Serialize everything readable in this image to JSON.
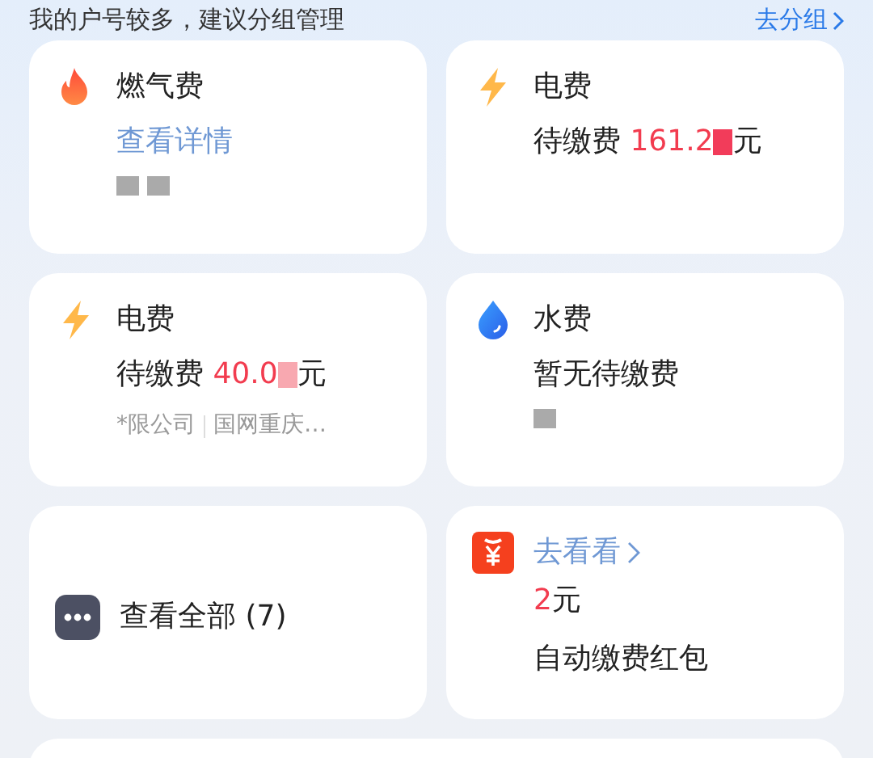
{
  "header": {
    "text": "我的户号较多，建议分组管理",
    "link": "去分组"
  },
  "bills": [
    {
      "kind": "gas",
      "title": "燃气费",
      "link": "查看详情"
    },
    {
      "kind": "electric",
      "title": "电费",
      "label": "待缴费",
      "amount": "161.2",
      "unit": "元"
    },
    {
      "kind": "electric",
      "title": "电费",
      "label": "待缴费",
      "amount": "40.0",
      "unit": "元",
      "notes": [
        "*限公司",
        "国网重庆…"
      ]
    },
    {
      "kind": "water",
      "title": "水费",
      "status": "暂无待缴费"
    }
  ],
  "view_all": {
    "label": "查看全部 (7)"
  },
  "promo": {
    "link": "去看看",
    "amount": "2",
    "unit": "元",
    "title": "自动缴费红包"
  }
}
